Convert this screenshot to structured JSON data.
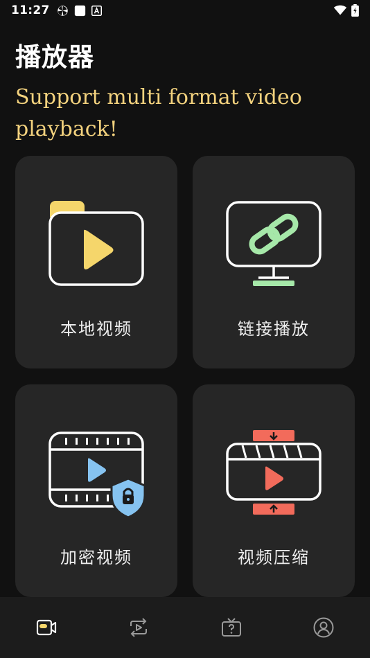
{
  "status": {
    "time": "11:27"
  },
  "header": {
    "title": "播放器",
    "slogan": "Support multi format video playback!"
  },
  "cards": [
    {
      "label": "本地视频",
      "icon": "folder-video-icon"
    },
    {
      "label": "链接播放",
      "icon": "monitor-link-icon"
    },
    {
      "label": "加密视频",
      "icon": "encrypted-film-icon"
    },
    {
      "label": "视频压缩",
      "icon": "video-compress-icon"
    }
  ],
  "nav": [
    {
      "icon": "video-camera-icon",
      "active": true
    },
    {
      "icon": "convert-icon",
      "active": false
    },
    {
      "icon": "tv-help-icon",
      "active": false
    },
    {
      "icon": "profile-icon",
      "active": false
    }
  ],
  "colors": {
    "background": "#111111",
    "card": "#262626",
    "slogan": "#f3d27e",
    "accent_yellow": "#f5d66b",
    "accent_green": "#a6e8a9",
    "accent_blue": "#86c3f0",
    "accent_red": "#f26b5b"
  }
}
